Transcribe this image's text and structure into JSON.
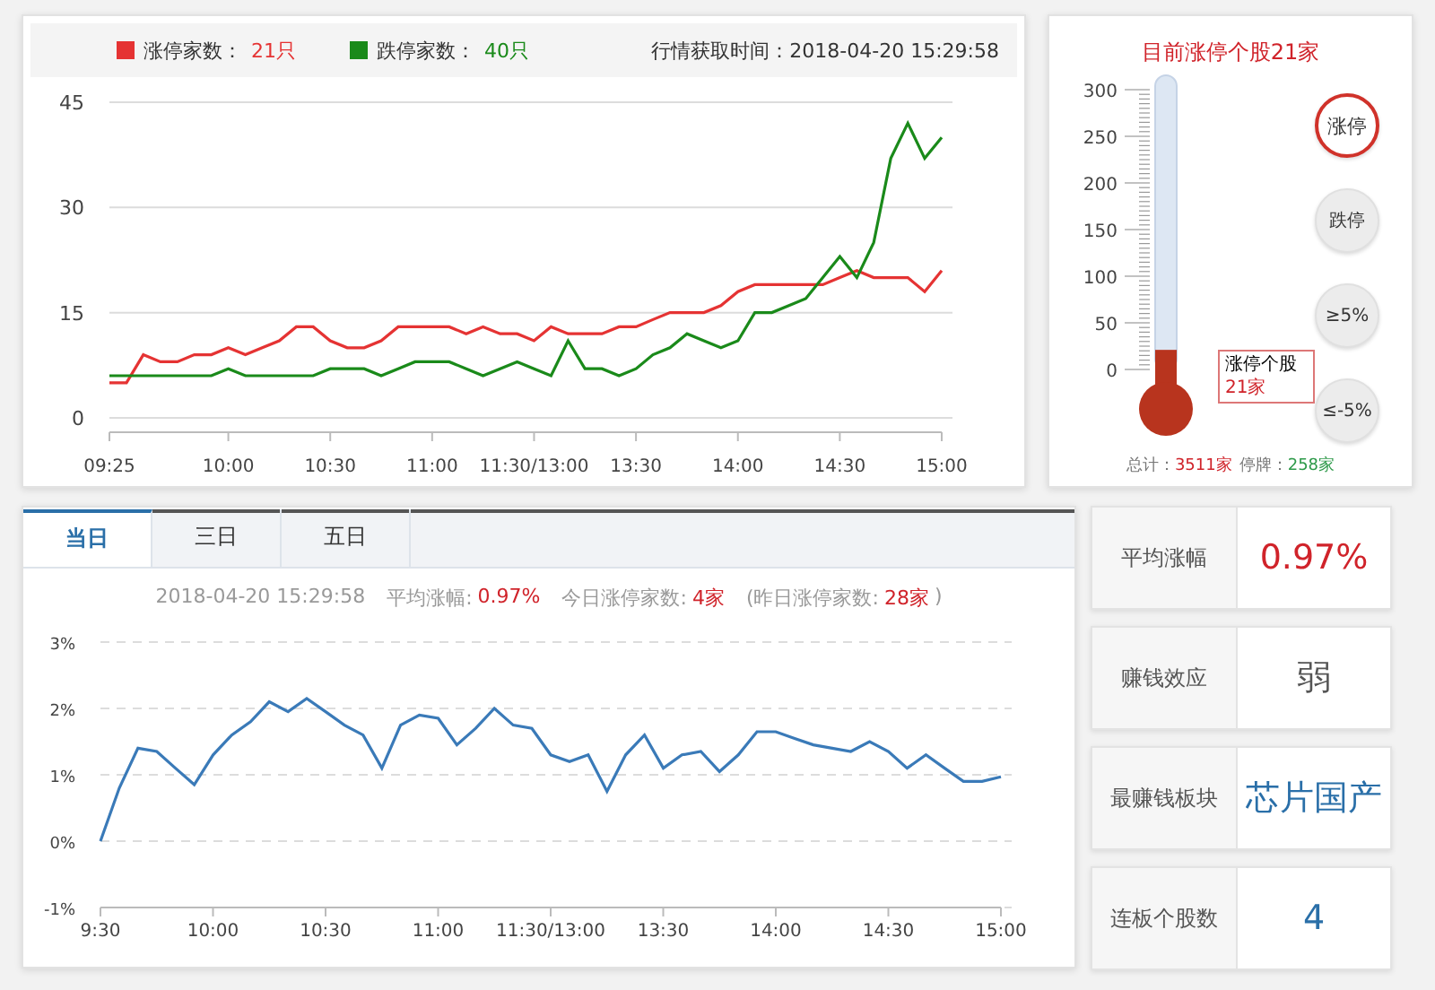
{
  "limit_chart": {
    "legend": [
      {
        "count": "21只"
      },
      {
        "count": "40只"
      }
    ],
    "timestamp": "行情获取时间：2018-04-20 15:29:58",
    "chart_data": {
      "type": "line",
      "categories": [
        "09:25",
        null,
        null,
        null,
        null,
        null,
        null,
        "10:00",
        null,
        null,
        null,
        null,
        null,
        "10:30",
        null,
        null,
        null,
        null,
        null,
        "11:00",
        null,
        null,
        null,
        null,
        null,
        "11:30/13:00",
        null,
        null,
        null,
        null,
        null,
        "13:30",
        null,
        null,
        null,
        null,
        null,
        "14:00",
        null,
        null,
        null,
        null,
        null,
        "14:30",
        null,
        null,
        null,
        null,
        null,
        "15:00"
      ],
      "series": [
        {
          "name": "涨停家数：",
          "color": "#e53333",
          "values": [
            5,
            5,
            9,
            8,
            8,
            9,
            9,
            10,
            9,
            10,
            11,
            13,
            13,
            11,
            10,
            10,
            11,
            13,
            13,
            13,
            13,
            12,
            13,
            12,
            12,
            11,
            13,
            12,
            12,
            12,
            13,
            13,
            14,
            15,
            15,
            15,
            16,
            18,
            19,
            19,
            19,
            19,
            19,
            20,
            21,
            20,
            20,
            20,
            18,
            21
          ]
        },
        {
          "name": "跌停家数：",
          "color": "#1a8a1a",
          "values": [
            6,
            6,
            6,
            6,
            6,
            6,
            6,
            7,
            6,
            6,
            6,
            6,
            6,
            7,
            7,
            7,
            6,
            7,
            8,
            8,
            8,
            7,
            6,
            7,
            8,
            7,
            6,
            11,
            7,
            7,
            6,
            7,
            9,
            10,
            12,
            11,
            10,
            11,
            15,
            15,
            16,
            17,
            20,
            23,
            20,
            25,
            37,
            42,
            37,
            40
          ]
        }
      ],
      "ylim": [
        0,
        45
      ],
      "yticks": [
        0,
        15,
        30,
        45
      ],
      "grid": true
    }
  },
  "thermometer": {
    "title": "目前涨停个股21家",
    "scale_ticks": [
      "300",
      "250",
      "200",
      "150",
      "100",
      "50",
      "0"
    ],
    "level": 0.07,
    "tooltip": {
      "label": "涨停个股",
      "value": "21家"
    },
    "buttons": [
      {
        "label": "涨停",
        "selected": true
      },
      {
        "label": "跌停",
        "selected": false
      },
      {
        "label": "≥5%",
        "selected": false
      },
      {
        "label": "≤-5%",
        "selected": false
      }
    ],
    "footer": [
      {
        "label": "总计：",
        "value": "3511家",
        "color": "#d0232a"
      },
      {
        "label": "停牌：",
        "value": "258家",
        "color": "#2e9a4a"
      }
    ]
  },
  "trend": {
    "tabs": [
      {
        "label": "当日",
        "selected": true
      },
      {
        "label": "三日",
        "selected": false
      },
      {
        "label": "五日",
        "selected": false
      }
    ],
    "timestamp": "2018-04-20 15:29:58",
    "summary": [
      {
        "label": "平均涨幅:",
        "value": "0.97%"
      },
      {
        "label": "今日涨停家数:",
        "value": "4家"
      },
      {
        "label": "(昨日涨停家数:",
        "value": "28家",
        "suffix": ")"
      }
    ],
    "chart_data": {
      "type": "line",
      "categories": [
        "9:30",
        null,
        null,
        null,
        null,
        null,
        "10:00",
        null,
        null,
        null,
        null,
        null,
        "10:30",
        null,
        null,
        null,
        null,
        null,
        "11:00",
        null,
        null,
        null,
        null,
        null,
        "11:30/13:00",
        null,
        null,
        null,
        null,
        null,
        "13:30",
        null,
        null,
        null,
        null,
        null,
        "14:00",
        null,
        null,
        null,
        null,
        null,
        "14:30",
        null,
        null,
        null,
        null,
        null,
        "15:00"
      ],
      "values": [
        0,
        0.8,
        1.4,
        1.35,
        1.1,
        0.85,
        1.3,
        1.6,
        1.8,
        2.1,
        1.95,
        2.15,
        1.95,
        1.75,
        1.6,
        1.1,
        1.75,
        1.9,
        1.85,
        1.45,
        1.7,
        2.0,
        1.75,
        1.7,
        1.3,
        1.2,
        1.3,
        0.75,
        1.3,
        1.6,
        1.1,
        1.3,
        1.35,
        1.05,
        1.3,
        1.65,
        1.65,
        1.55,
        1.45,
        1.4,
        1.35,
        1.5,
        1.35,
        1.1,
        1.3,
        1.1,
        0.9,
        0.9,
        0.97
      ],
      "ylim": [
        -1,
        3
      ],
      "grid": true,
      "yticks": [
        {
          "value": -1,
          "label": "-1%"
        },
        {
          "value": 0,
          "label": "0%"
        },
        {
          "value": 1,
          "label": "1%"
        },
        {
          "value": 2,
          "label": "2%"
        },
        {
          "value": 3,
          "label": "3%"
        }
      ]
    }
  },
  "stats": [
    {
      "label": "平均涨幅",
      "value": "0.97%",
      "color": "#d0232a"
    },
    {
      "label": "赚钱效应",
      "value": "弱",
      "color": "#555555"
    },
    {
      "label": "最赚钱板块",
      "value": "芯片国产",
      "color": "#2a6fa8"
    },
    {
      "label": "连板个股数",
      "value": "4",
      "color": "#2a6fa8"
    }
  ]
}
